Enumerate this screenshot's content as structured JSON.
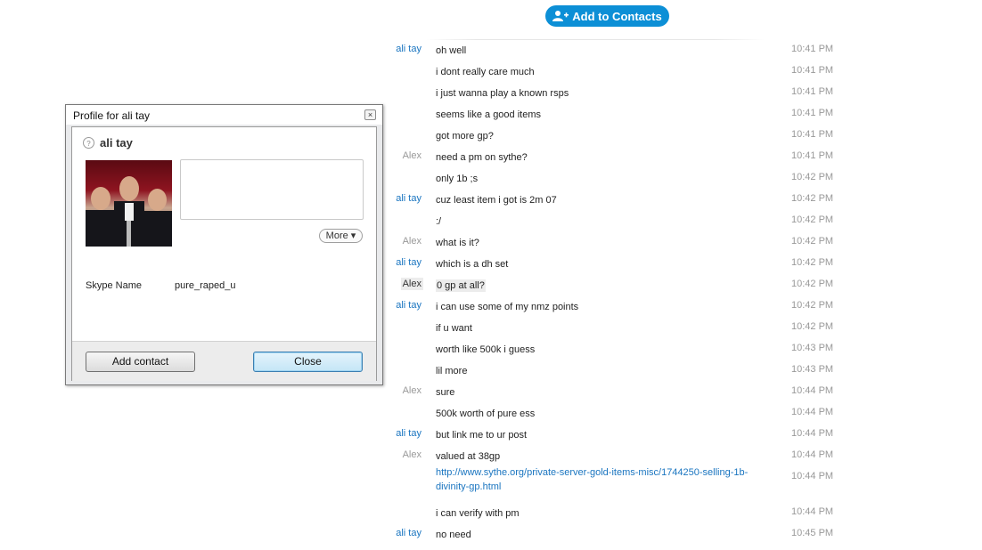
{
  "header": {
    "add_contacts_label": "Add to Contacts"
  },
  "messages": [
    {
      "sender": "ali tay",
      "text": "oh well",
      "time": "10:41 PM"
    },
    {
      "sender": "",
      "text": "i dont really care much",
      "time": "10:41 PM"
    },
    {
      "sender": "",
      "text": "i just wanna play a known rsps",
      "time": "10:41 PM"
    },
    {
      "sender": "",
      "text": "seems like a good items",
      "time": "10:41 PM"
    },
    {
      "sender": "",
      "text": "got more gp?",
      "time": "10:41 PM"
    },
    {
      "sender": "Alex",
      "text": "need a pm on sythe?",
      "time": "10:41 PM"
    },
    {
      "sender": "",
      "text": "only 1b ;s",
      "time": "10:42 PM"
    },
    {
      "sender": "ali tay",
      "text": "cuz least item i got is 2m 07",
      "time": "10:42 PM"
    },
    {
      "sender": "",
      "text": ":/",
      "time": "10:42 PM"
    },
    {
      "sender": "Alex",
      "text": "what is it?",
      "time": "10:42 PM"
    },
    {
      "sender": "ali tay",
      "text": "which is a dh set",
      "time": "10:42 PM"
    },
    {
      "sender": "Alex",
      "text": "0 gp at all?",
      "time": "10:42 PM",
      "highlight": true
    },
    {
      "sender": "ali tay",
      "text": "i can use some of my nmz points",
      "time": "10:42 PM"
    },
    {
      "sender": "",
      "text": "if u want",
      "time": "10:42 PM"
    },
    {
      "sender": "",
      "text": "worth like 500k i guess",
      "time": "10:43 PM"
    },
    {
      "sender": "",
      "text": "lil more",
      "time": "10:43 PM"
    },
    {
      "sender": "Alex",
      "text": "sure",
      "time": "10:44 PM"
    },
    {
      "sender": "",
      "text": "500k worth of pure ess",
      "time": "10:44 PM"
    },
    {
      "sender": "ali tay",
      "text": "but link me to ur post",
      "time": "10:44 PM"
    },
    {
      "sender": "Alex",
      "text": "valued at 38gp",
      "time": "10:44 PM"
    },
    {
      "sender": "",
      "text": "http://www.sythe.org/private-server-gold-items-misc/1744250-selling-1b-divinity-gp.html",
      "time": "10:44 PM",
      "link": true
    },
    {
      "sender": "",
      "text": "i can verify with pm",
      "time": "10:44 PM"
    },
    {
      "sender": "ali tay",
      "text": "no need",
      "time": "10:45 PM"
    }
  ],
  "profile": {
    "window_title": "Profile for ali tay",
    "name": "ali tay",
    "more_label": "More",
    "skype_name_label": "Skype Name",
    "skype_name_value": "pure_raped_u",
    "add_contact_label": "Add contact",
    "close_label": "Close"
  },
  "colors": {
    "accent": "#0c8fd6",
    "sender_ali": "#1a75c0",
    "sender_alex": "#999999",
    "timestamp": "#999999"
  }
}
